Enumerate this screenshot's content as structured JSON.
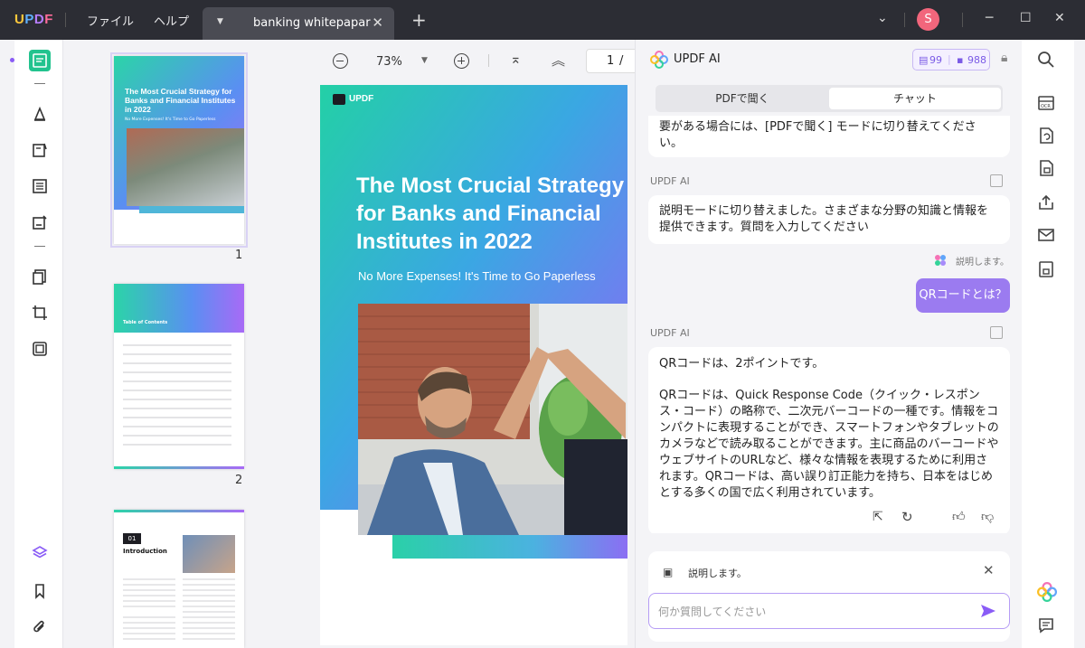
{
  "titlebar": {
    "logo": [
      "U",
      "P",
      "D",
      "F"
    ],
    "menu_file": "ファイル",
    "menu_help": "ヘルプ",
    "tab_title": "banking whitepapar",
    "avatar_initial": "S"
  },
  "viewbar": {
    "zoom": "73%",
    "page_current": "1",
    "page_sep": "/"
  },
  "thumbnails": [
    {
      "page": "1",
      "title": "The Most Crucial Strategy for Banks and Financial Institutes in 2022",
      "subtitle": "No More Expenses! It's Time to Go Paperless"
    },
    {
      "page": "2",
      "title": "Table of Contents"
    },
    {
      "page": "",
      "chapter": "01",
      "title": "Introduction"
    }
  ],
  "document": {
    "brand": "UPDF",
    "title_line1": "The Most Crucial Strategy",
    "title_line2": "for Banks and Financial",
    "title_line3": "Institutes in 2022",
    "subtitle": "No More Expenses! It's Time to Go Paperless"
  },
  "ai_panel": {
    "title": "UPDF AI",
    "credits_doc": "99",
    "credits_chat": "988",
    "tab_pdf": "PDFで聞く",
    "tab_chat": "チャット",
    "msg_prev_fragment": "要がある場合には、[PDFで聞く] モードに切り替えてくださ\nい。",
    "label_ai_1": "UPDF AI",
    "msg_ai_1": "説明モードに切り替えました。さまざまな分野の知識と情報を提供できます。質問を入力してください",
    "mode_hint": "説明します。",
    "user_msg": "QRコードとは？",
    "label_ai_2": "UPDF AI",
    "msg_ai_2_p1": "QRコードは、2ポイントです。",
    "msg_ai_2_p2": "QRコードは、Quick Response Code（クイック・レスポンス・コード）の略称で、二次元バーコードの一種です。情報をコンパクトに表現することができ、スマートフォンやタブレットのカメラなどで読み取ることができます。主に商品のバーコードやウェブサイトのURLなど、様々な情報を表現するために利用されます。QRコードは、高い誤り訂正能力を持ち、日本をはじめとする多くの国で広く利用されています。",
    "mode_chip": "説明します。",
    "input_placeholder": "何か質問してください"
  },
  "colors": {
    "accent": "#8a5cf6",
    "green": "#22c38e",
    "titlebar": "#2c2d34",
    "gradient_start": "#2bd4a8",
    "gradient_end": "#8f6cf5"
  }
}
